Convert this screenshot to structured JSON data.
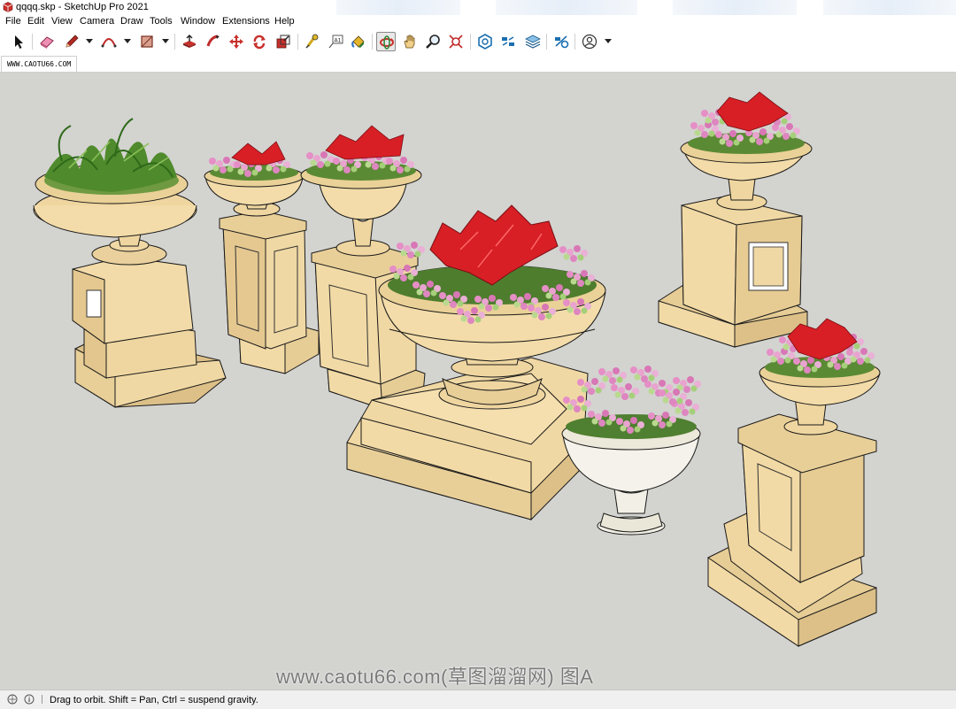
{
  "window": {
    "title": "qqqq.skp - SketchUp Pro 2021"
  },
  "menu": [
    "File",
    "Edit",
    "View",
    "Camera",
    "Draw",
    "Tools",
    "Window",
    "Extensions",
    "Help"
  ],
  "toolbar": {
    "tools": [
      {
        "id": "select",
        "icon": "select-arrow-icon"
      },
      {
        "id": "eraser",
        "icon": "eraser-icon"
      },
      {
        "id": "line",
        "icon": "pencil-icon",
        "dropdown": true
      },
      {
        "id": "arc",
        "icon": "arc-icon",
        "dropdown": true
      },
      {
        "id": "rectangle",
        "icon": "rectangle-icon",
        "dropdown": true
      },
      {
        "id": "push-pull",
        "icon": "push-pull-icon"
      },
      {
        "id": "follow-me",
        "icon": "follow-me-icon"
      },
      {
        "id": "move",
        "icon": "move-icon"
      },
      {
        "id": "rotate",
        "icon": "rotate-icon"
      },
      {
        "id": "scale",
        "icon": "scale-icon"
      },
      {
        "id": "tape-measure",
        "icon": "tape-measure-icon"
      },
      {
        "id": "text",
        "icon": "text-icon"
      },
      {
        "id": "paint-bucket",
        "icon": "paint-bucket-icon"
      },
      {
        "id": "orbit",
        "icon": "orbit-icon",
        "active": true
      },
      {
        "id": "pan",
        "icon": "pan-hand-icon"
      },
      {
        "id": "zoom",
        "icon": "zoom-icon"
      },
      {
        "id": "zoom-extents",
        "icon": "zoom-extents-icon"
      },
      {
        "id": "warehouse",
        "icon": "3d-warehouse-icon"
      },
      {
        "id": "extension-warehouse",
        "icon": "extension-warehouse-icon"
      },
      {
        "id": "layout",
        "icon": "layout-icon"
      },
      {
        "id": "extension-manager",
        "icon": "extension-manager-icon"
      },
      {
        "id": "profile",
        "icon": "profile-icon",
        "dropdown": true
      }
    ]
  },
  "tabs": [
    "WWW.CAOTU66.COM"
  ],
  "viewport": {
    "background": "#d3d3d0",
    "watermark": "www.caotu66.com(草图溜溜网) 图A"
  },
  "colors": {
    "stone": "#f0d8a4",
    "stone_shade": "#dcc088",
    "edge": "#1a1a1a",
    "leaf_red": "#d81f26",
    "flower_pink": "#e58fc6",
    "leaf_green": "#4f8a2c"
  },
  "status": {
    "text": "Drag to orbit. Shift = Pan, Ctrl = suspend gravity."
  }
}
